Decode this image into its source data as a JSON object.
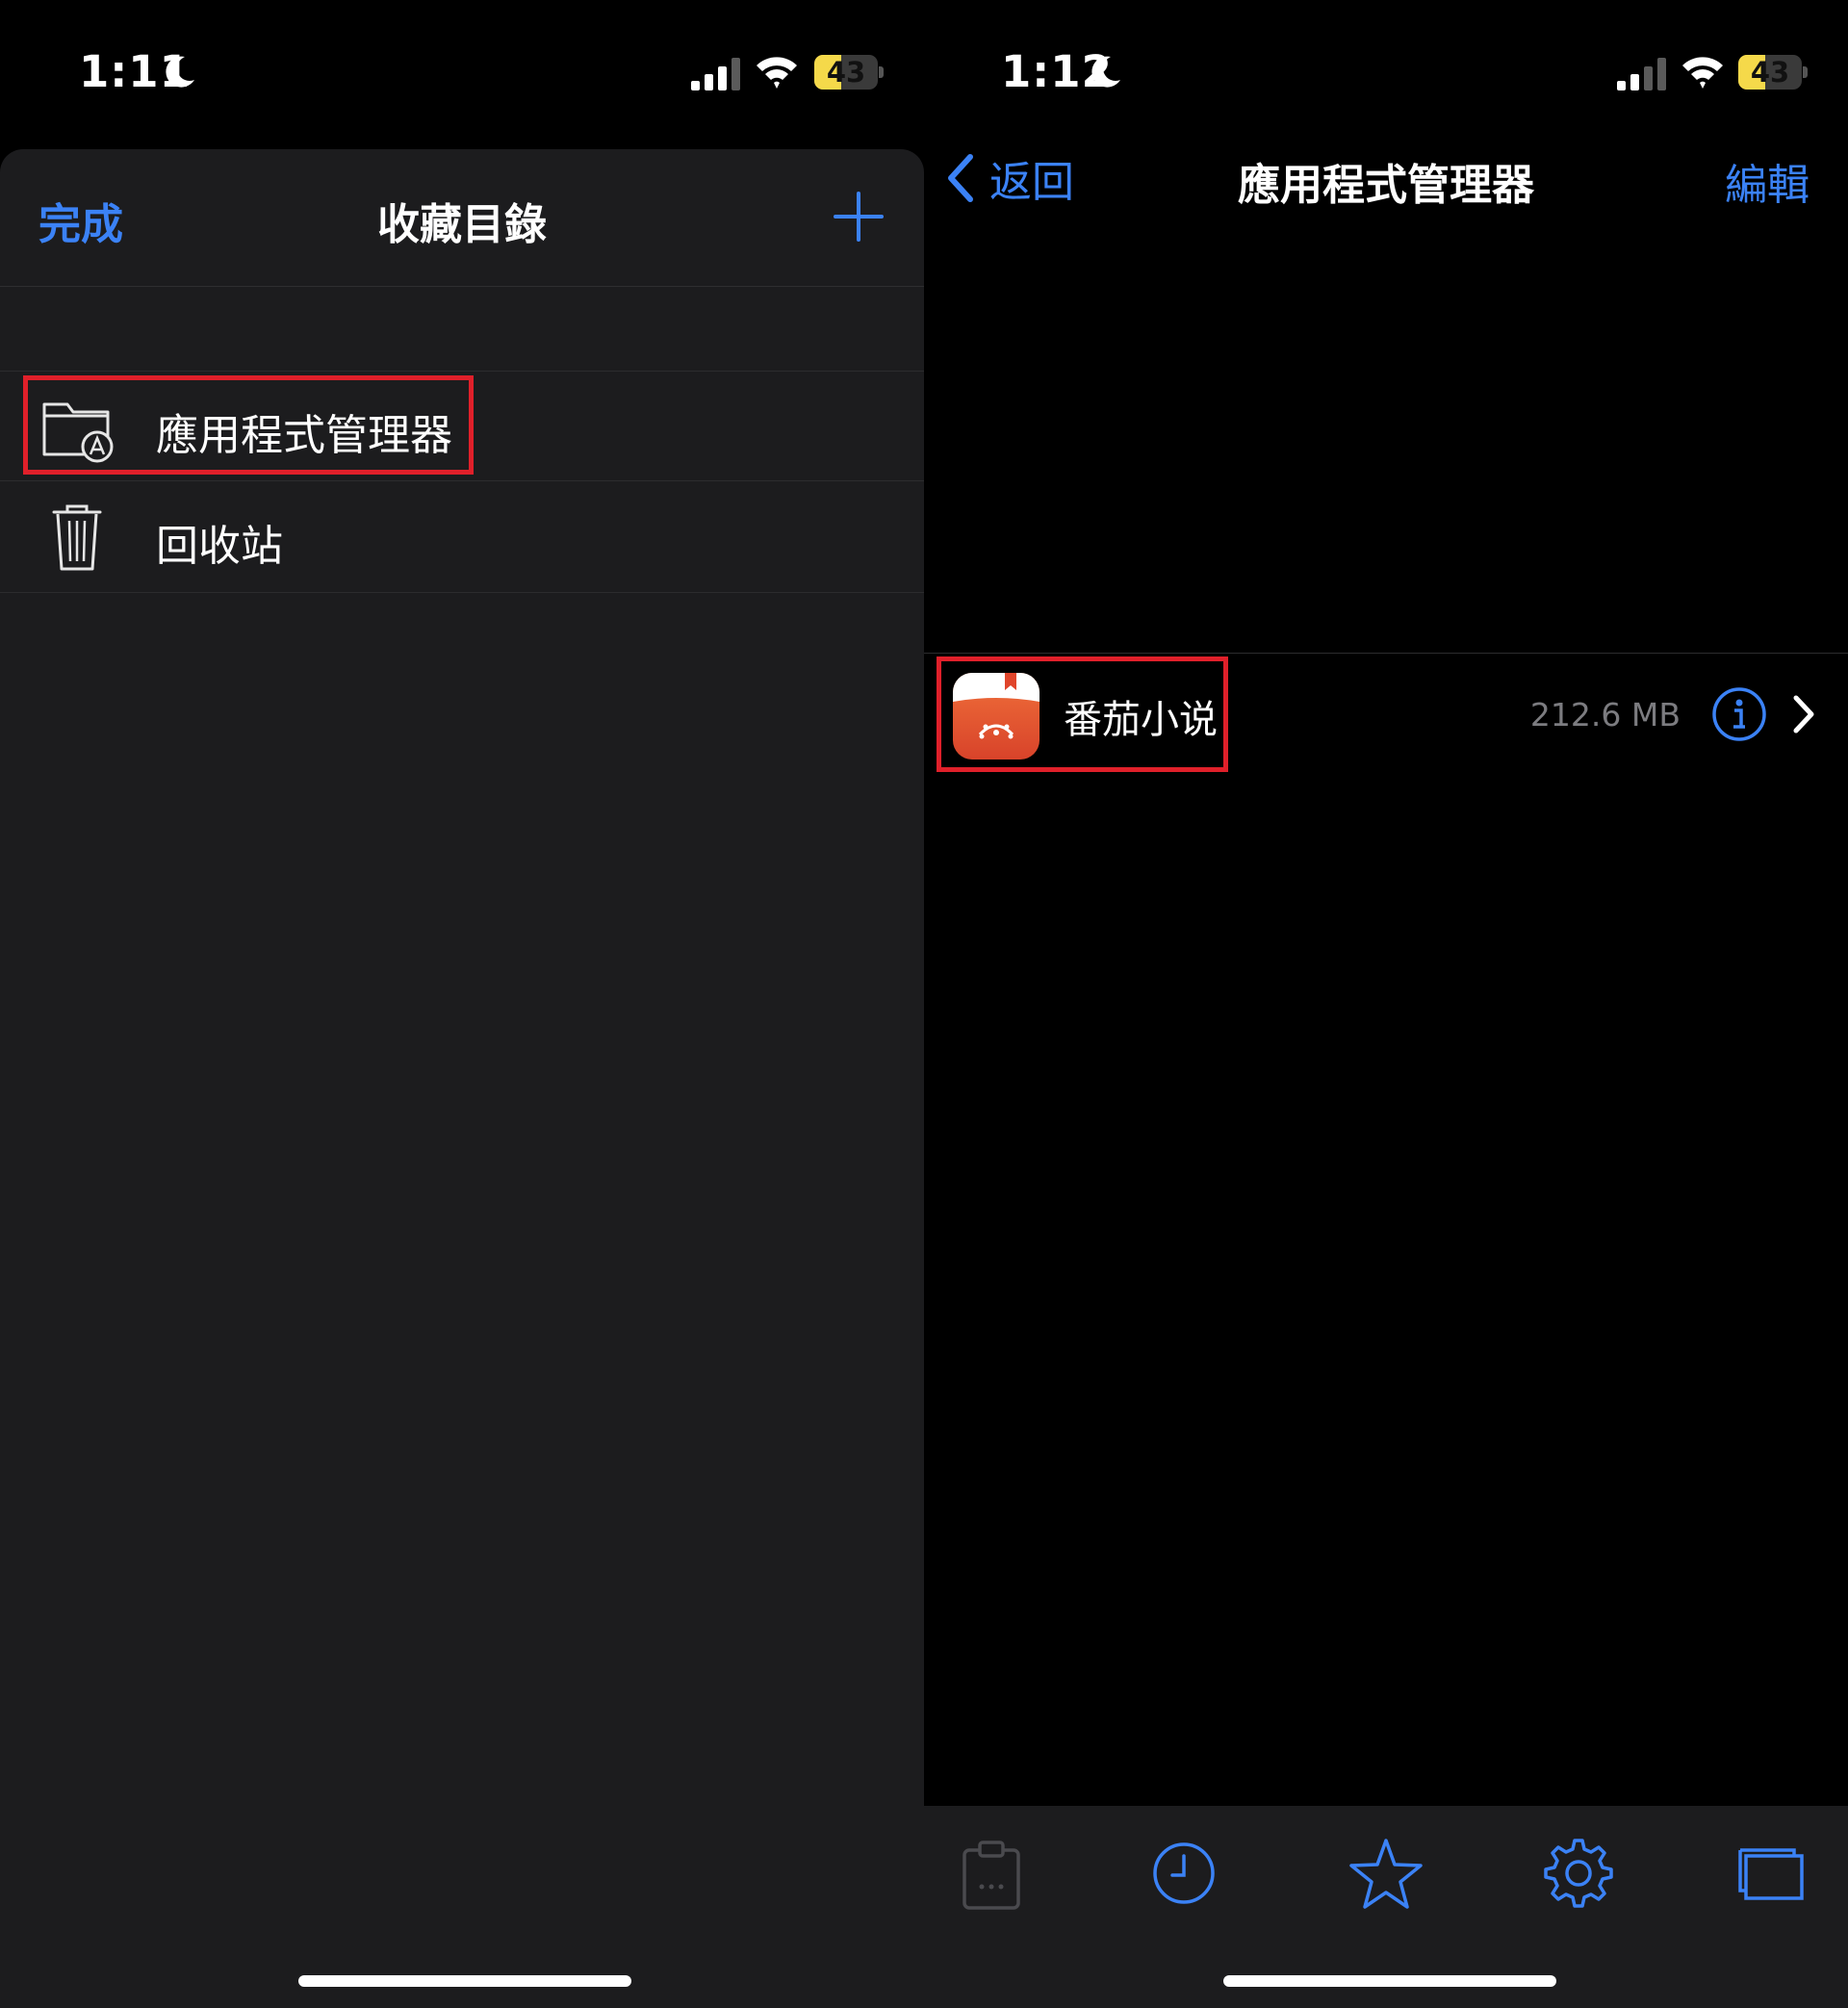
{
  "left": {
    "status": {
      "time": "1:11",
      "battery": "43",
      "battery_level": 0.43
    },
    "sheet": {
      "done_label": "完成",
      "title": "收藏目錄",
      "items": [
        {
          "label": "應用程式管理器",
          "icon": "folder-app-icon"
        },
        {
          "label": "回收站",
          "icon": "trash-icon"
        }
      ]
    }
  },
  "right": {
    "status": {
      "time": "1:12",
      "battery": "43",
      "battery_level": 0.43
    },
    "nav": {
      "back_label": "返回",
      "title": "應用程式管理器",
      "edit_label": "編輯"
    },
    "apps": [
      {
        "name": "番茄小说",
        "size": "212.6 MB"
      }
    ],
    "toolbar": [
      "clipboard-icon",
      "clock-icon",
      "star-icon",
      "gear-icon",
      "windows-icon"
    ]
  },
  "colors": {
    "accent": "#3b82f6",
    "highlight": "#e0202a",
    "sheet_bg": "#1c1c1e",
    "battery": "#f5d94a"
  }
}
